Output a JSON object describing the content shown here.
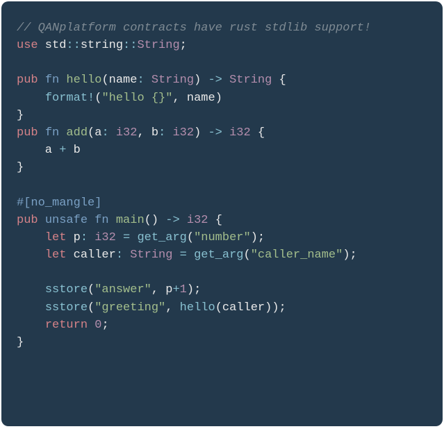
{
  "code": {
    "language": "rust",
    "lines": [
      [
        {
          "cls": "tok-comment",
          "t": "// QANplatform contracts have rust stdlib support!"
        }
      ],
      [
        {
          "cls": "tok-kw-red",
          "t": "use"
        },
        {
          "cls": "tok-ident",
          "t": " std"
        },
        {
          "cls": "tok-op",
          "t": "::"
        },
        {
          "cls": "tok-ident",
          "t": "string"
        },
        {
          "cls": "tok-op",
          "t": "::"
        },
        {
          "cls": "tok-type",
          "t": "String"
        },
        {
          "cls": "tok-punct",
          "t": ";"
        }
      ],
      [],
      [
        {
          "cls": "tok-kw-red",
          "t": "pub"
        },
        {
          "cls": "tok-ident",
          "t": " "
        },
        {
          "cls": "tok-kw-blue",
          "t": "fn"
        },
        {
          "cls": "tok-ident",
          "t": " "
        },
        {
          "cls": "tok-fn-name",
          "t": "hello"
        },
        {
          "cls": "tok-punct",
          "t": "("
        },
        {
          "cls": "tok-ident",
          "t": "name"
        },
        {
          "cls": "tok-op",
          "t": ":"
        },
        {
          "cls": "tok-ident",
          "t": " "
        },
        {
          "cls": "tok-type",
          "t": "String"
        },
        {
          "cls": "tok-punct",
          "t": ")"
        },
        {
          "cls": "tok-ident",
          "t": " "
        },
        {
          "cls": "tok-op",
          "t": "->"
        },
        {
          "cls": "tok-ident",
          "t": " "
        },
        {
          "cls": "tok-type",
          "t": "String"
        },
        {
          "cls": "tok-ident",
          "t": " "
        },
        {
          "cls": "tok-punct",
          "t": "{"
        }
      ],
      [
        {
          "cls": "tok-ident",
          "t": "    "
        },
        {
          "cls": "tok-call",
          "t": "format!"
        },
        {
          "cls": "tok-punct",
          "t": "("
        },
        {
          "cls": "tok-str",
          "t": "\"hello {}\""
        },
        {
          "cls": "tok-punct",
          "t": ","
        },
        {
          "cls": "tok-ident",
          "t": " name"
        },
        {
          "cls": "tok-punct",
          "t": ")"
        }
      ],
      [
        {
          "cls": "tok-punct",
          "t": "}"
        }
      ],
      [
        {
          "cls": "tok-kw-red",
          "t": "pub"
        },
        {
          "cls": "tok-ident",
          "t": " "
        },
        {
          "cls": "tok-kw-blue",
          "t": "fn"
        },
        {
          "cls": "tok-ident",
          "t": " "
        },
        {
          "cls": "tok-fn-name",
          "t": "add"
        },
        {
          "cls": "tok-punct",
          "t": "("
        },
        {
          "cls": "tok-ident",
          "t": "a"
        },
        {
          "cls": "tok-op",
          "t": ":"
        },
        {
          "cls": "tok-ident",
          "t": " "
        },
        {
          "cls": "tok-type",
          "t": "i32"
        },
        {
          "cls": "tok-punct",
          "t": ","
        },
        {
          "cls": "tok-ident",
          "t": " b"
        },
        {
          "cls": "tok-op",
          "t": ":"
        },
        {
          "cls": "tok-ident",
          "t": " "
        },
        {
          "cls": "tok-type",
          "t": "i32"
        },
        {
          "cls": "tok-punct",
          "t": ")"
        },
        {
          "cls": "tok-ident",
          "t": " "
        },
        {
          "cls": "tok-op",
          "t": "->"
        },
        {
          "cls": "tok-ident",
          "t": " "
        },
        {
          "cls": "tok-type",
          "t": "i32"
        },
        {
          "cls": "tok-ident",
          "t": " "
        },
        {
          "cls": "tok-punct",
          "t": "{"
        }
      ],
      [
        {
          "cls": "tok-ident",
          "t": "    a "
        },
        {
          "cls": "tok-op",
          "t": "+"
        },
        {
          "cls": "tok-ident",
          "t": " b"
        }
      ],
      [
        {
          "cls": "tok-punct",
          "t": "}"
        }
      ],
      [],
      [
        {
          "cls": "tok-kw-blue",
          "t": "#[no_mangle]"
        }
      ],
      [
        {
          "cls": "tok-kw-red",
          "t": "pub"
        },
        {
          "cls": "tok-ident",
          "t": " "
        },
        {
          "cls": "tok-kw-blue",
          "t": "unsafe"
        },
        {
          "cls": "tok-ident",
          "t": " "
        },
        {
          "cls": "tok-kw-blue",
          "t": "fn"
        },
        {
          "cls": "tok-ident",
          "t": " "
        },
        {
          "cls": "tok-fn-name",
          "t": "main"
        },
        {
          "cls": "tok-punct",
          "t": "()"
        },
        {
          "cls": "tok-ident",
          "t": " "
        },
        {
          "cls": "tok-op",
          "t": "->"
        },
        {
          "cls": "tok-ident",
          "t": " "
        },
        {
          "cls": "tok-type",
          "t": "i32"
        },
        {
          "cls": "tok-ident",
          "t": " "
        },
        {
          "cls": "tok-punct",
          "t": "{"
        }
      ],
      [
        {
          "cls": "tok-ident",
          "t": "    "
        },
        {
          "cls": "tok-kw-red",
          "t": "let"
        },
        {
          "cls": "tok-ident",
          "t": " p"
        },
        {
          "cls": "tok-op",
          "t": ":"
        },
        {
          "cls": "tok-ident",
          "t": " "
        },
        {
          "cls": "tok-type",
          "t": "i32"
        },
        {
          "cls": "tok-ident",
          "t": " "
        },
        {
          "cls": "tok-op",
          "t": "="
        },
        {
          "cls": "tok-ident",
          "t": " "
        },
        {
          "cls": "tok-call",
          "t": "get_arg"
        },
        {
          "cls": "tok-punct",
          "t": "("
        },
        {
          "cls": "tok-str",
          "t": "\"number\""
        },
        {
          "cls": "tok-punct",
          "t": ")"
        },
        {
          "cls": "tok-punct",
          "t": ";"
        }
      ],
      [
        {
          "cls": "tok-ident",
          "t": "    "
        },
        {
          "cls": "tok-kw-red",
          "t": "let"
        },
        {
          "cls": "tok-ident",
          "t": " caller"
        },
        {
          "cls": "tok-op",
          "t": ":"
        },
        {
          "cls": "tok-ident",
          "t": " "
        },
        {
          "cls": "tok-type",
          "t": "String"
        },
        {
          "cls": "tok-ident",
          "t": " "
        },
        {
          "cls": "tok-op",
          "t": "="
        },
        {
          "cls": "tok-ident",
          "t": " "
        },
        {
          "cls": "tok-call",
          "t": "get_arg"
        },
        {
          "cls": "tok-punct",
          "t": "("
        },
        {
          "cls": "tok-str",
          "t": "\"caller_name\""
        },
        {
          "cls": "tok-punct",
          "t": ")"
        },
        {
          "cls": "tok-punct",
          "t": ";"
        }
      ],
      [],
      [
        {
          "cls": "tok-ident",
          "t": "    "
        },
        {
          "cls": "tok-call",
          "t": "sstore"
        },
        {
          "cls": "tok-punct",
          "t": "("
        },
        {
          "cls": "tok-str",
          "t": "\"answer\""
        },
        {
          "cls": "tok-punct",
          "t": ","
        },
        {
          "cls": "tok-ident",
          "t": " p"
        },
        {
          "cls": "tok-op",
          "t": "+"
        },
        {
          "cls": "tok-num",
          "t": "1"
        },
        {
          "cls": "tok-punct",
          "t": ")"
        },
        {
          "cls": "tok-punct",
          "t": ";"
        }
      ],
      [
        {
          "cls": "tok-ident",
          "t": "    "
        },
        {
          "cls": "tok-call",
          "t": "sstore"
        },
        {
          "cls": "tok-punct",
          "t": "("
        },
        {
          "cls": "tok-str",
          "t": "\"greeting\""
        },
        {
          "cls": "tok-punct",
          "t": ","
        },
        {
          "cls": "tok-ident",
          "t": " "
        },
        {
          "cls": "tok-call",
          "t": "hello"
        },
        {
          "cls": "tok-punct",
          "t": "("
        },
        {
          "cls": "tok-ident",
          "t": "caller"
        },
        {
          "cls": "tok-punct",
          "t": ")"
        },
        {
          "cls": "tok-punct",
          "t": ")"
        },
        {
          "cls": "tok-punct",
          "t": ";"
        }
      ],
      [
        {
          "cls": "tok-ident",
          "t": "    "
        },
        {
          "cls": "tok-kw-red",
          "t": "return"
        },
        {
          "cls": "tok-ident",
          "t": " "
        },
        {
          "cls": "tok-num",
          "t": "0"
        },
        {
          "cls": "tok-punct",
          "t": ";"
        }
      ],
      [
        {
          "cls": "tok-punct",
          "t": "}"
        }
      ]
    ]
  }
}
